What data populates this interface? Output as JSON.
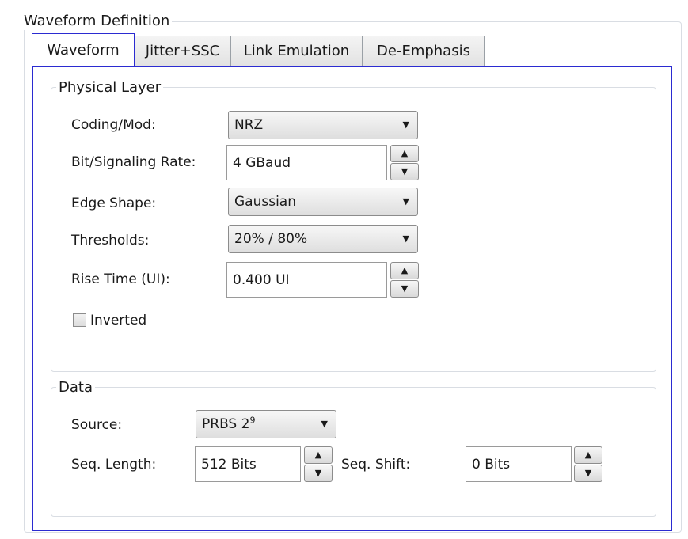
{
  "waveform_definition": {
    "title": "Waveform Definition",
    "tabs": [
      "Waveform",
      "Jitter+SSC",
      "Link Emulation",
      "De-Emphasis"
    ],
    "active_tab": "Waveform"
  },
  "physical_layer": {
    "title": "Physical Layer",
    "coding_mod": {
      "label": "Coding/Mod:",
      "value": "NRZ"
    },
    "bit_rate": {
      "label": "Bit/Signaling Rate:",
      "value": "4 GBaud"
    },
    "edge_shape": {
      "label": "Edge Shape:",
      "value": "Gaussian"
    },
    "thresholds": {
      "label": "Thresholds:",
      "value": "20% / 80%"
    },
    "rise_time": {
      "label": "Rise Time (UI):",
      "value": "0.400 UI"
    },
    "inverted": {
      "label": "Inverted",
      "checked": false
    }
  },
  "data_section": {
    "title": "Data",
    "source": {
      "label": "Source:",
      "value_base": "PRBS 2",
      "value_exp": "9"
    },
    "seq_length": {
      "label": "Seq. Length:",
      "value": "512 Bits"
    },
    "seq_shift": {
      "label": "Seq. Shift:",
      "value": "0 Bits"
    }
  },
  "icons": {
    "spin_up": "arrow-up-icon",
    "spin_down": "arrow-down-icon",
    "dropdown": "dropdown-arrow-icon"
  },
  "colors": {
    "tab_border_active": "#2b2bd1",
    "group_border": "#d9dde3",
    "control_border": "#8c8c8c"
  }
}
